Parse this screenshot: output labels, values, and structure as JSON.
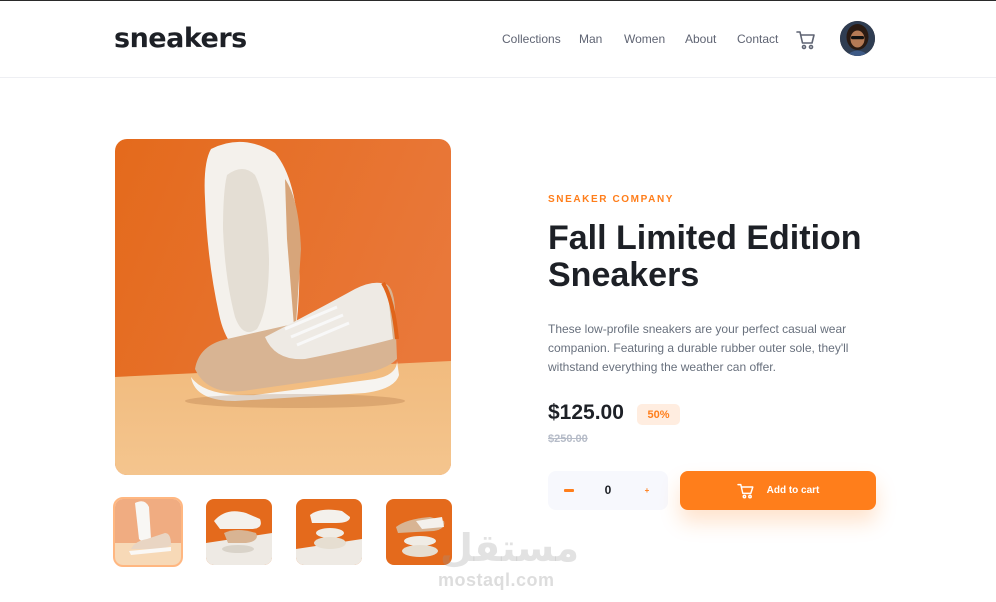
{
  "header": {
    "logo": "sneakers",
    "nav": [
      {
        "label": "Collections"
      },
      {
        "label": "Man"
      },
      {
        "label": "Women"
      },
      {
        "label": "About"
      },
      {
        "label": "Contact"
      }
    ],
    "cart_icon": "cart-icon",
    "avatar": "user-avatar"
  },
  "gallery": {
    "main_image": "sneaker-product-photo",
    "thumbnails": [
      "thumbnail-1",
      "thumbnail-2",
      "thumbnail-3",
      "thumbnail-4"
    ],
    "active_thumbnail": 1
  },
  "product": {
    "company": "SNEAKER COMPANY",
    "title": "Fall Limited Edition Sneakers",
    "description": "These low-profile sneakers are your perfect casual wear companion. Featuring a durable rubber outer sole, they'll withstand everything the weather can offer.",
    "price": "$125.00",
    "discount": "50%",
    "original_price": "$250.00"
  },
  "cart": {
    "quantity": "0",
    "minus_icon": "minus-icon",
    "plus_icon": "plus-icon",
    "add_label": "Add to cart"
  },
  "watermark": {
    "arabic": "مستقل",
    "latin": "mostaql.com"
  },
  "colors": {
    "accent": "#ff7e1b",
    "accent_pale": "#ffede0",
    "dark": "#1d2026",
    "text_muted": "#68707d"
  }
}
